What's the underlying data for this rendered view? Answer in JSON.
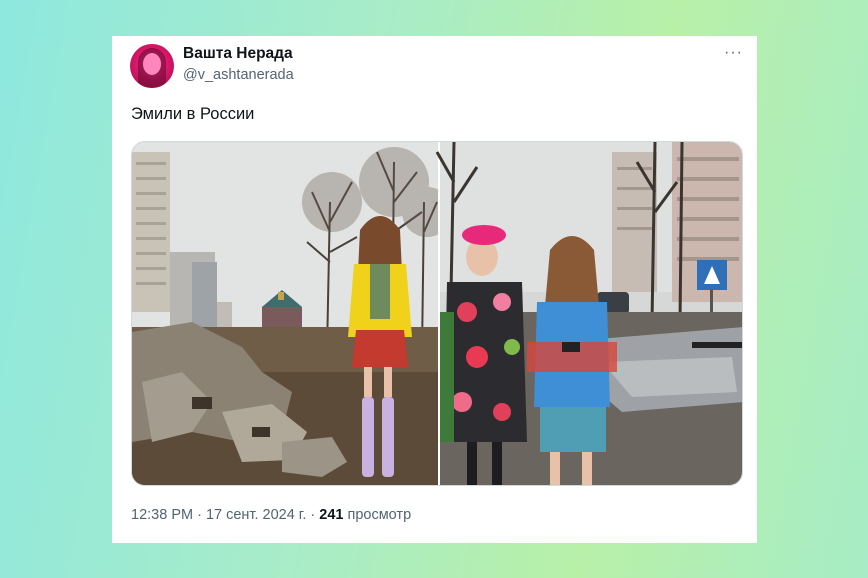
{
  "tweet": {
    "author_name": "Ваштa Нерада",
    "author_handle": "@v_ashtanerada",
    "more_label": "···",
    "text": "Эмили в России",
    "time": "12:38 PM · 17 сент. 2024 г. · ",
    "views_count": "241",
    "views_label": " просмотр"
  },
  "media": {
    "left_alt": "Woman in yellow jacket and lilac boots posing among ruins and snowless mud near apartment blocks",
    "right_alt": "Two women in colorful floral outfits on a muddy street with puddles near high-rise buildings"
  },
  "colors": {
    "background_start": "#8ee8de",
    "background_end": "#b8f0a8",
    "card": "#ffffff",
    "text_primary": "#0f1419",
    "text_secondary": "#536471"
  }
}
